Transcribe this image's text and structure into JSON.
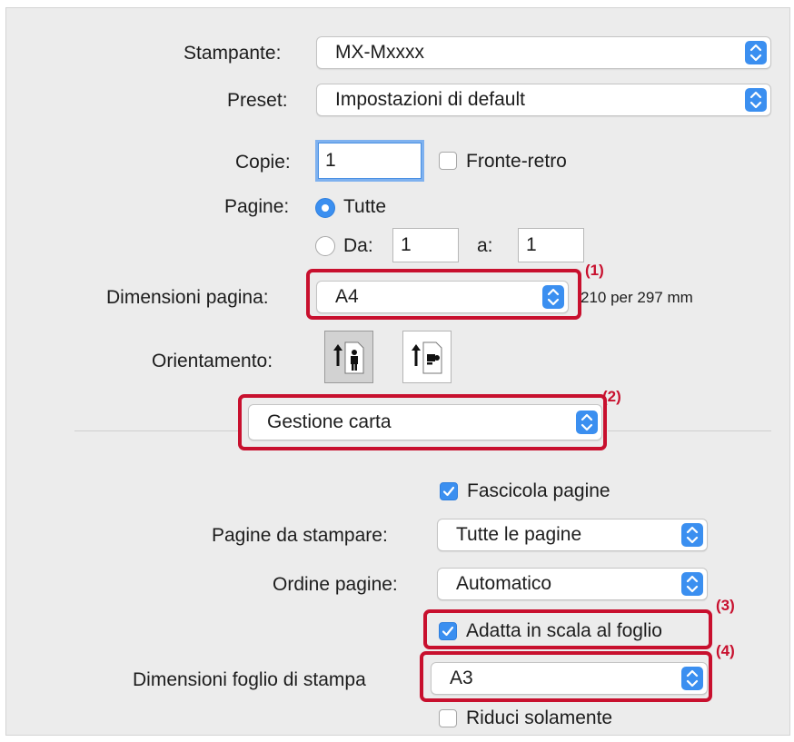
{
  "printer": {
    "label": "Stampante:",
    "value": "MX-Mxxxx"
  },
  "preset": {
    "label": "Preset:",
    "value": "Impostazioni di default"
  },
  "copies": {
    "label": "Copie:",
    "value": "1",
    "duplex_label": "Fronte-retro",
    "duplex_checked": false
  },
  "pages": {
    "label": "Pagine:",
    "all_label": "Tutte",
    "from_label": "Da:",
    "from_value": "1",
    "to_label": "a:",
    "to_value": "1",
    "selected": "all"
  },
  "paper_size": {
    "label": "Dimensioni pagina:",
    "value": "A4",
    "dimensions": "210 per 297 mm"
  },
  "orientation": {
    "label": "Orientamento:",
    "selected": "portrait",
    "options": [
      "portrait-icon",
      "landscape-icon"
    ]
  },
  "section": {
    "value": "Gestione carta"
  },
  "paper_handling": {
    "collate_label": "Fascicola pagine",
    "collate_checked": true,
    "pages_to_print_label": "Pagine da stampare:",
    "pages_to_print_value": "Tutte le pagine",
    "page_order_label": "Ordine pagine:",
    "page_order_value": "Automatico",
    "scale_label": "Adatta in scala al foglio",
    "scale_checked": true,
    "dest_size_label": "Dimensioni foglio di stampa",
    "dest_size_value": "A3",
    "scale_down_label": "Riduci solamente",
    "scale_down_checked": false
  },
  "annotations": [
    "(1)",
    "(2)",
    "(3)",
    "(4)"
  ],
  "colors": {
    "accent": "#3b8ff0",
    "annotation": "#c8102e",
    "panel": "#ececec"
  }
}
